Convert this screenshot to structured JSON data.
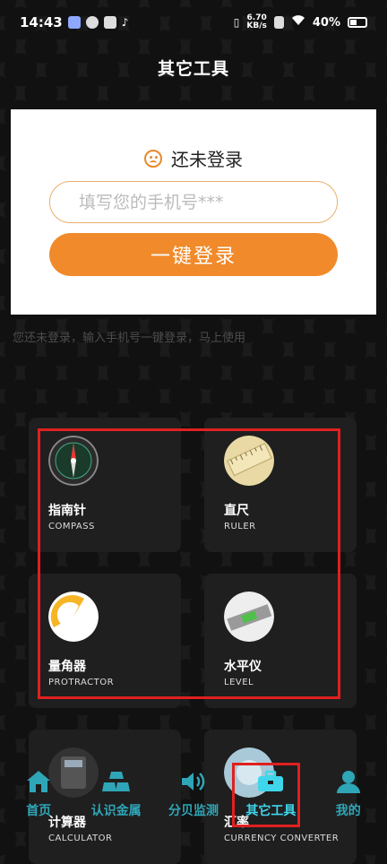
{
  "status_bar": {
    "time": "14:43",
    "net_speed_value": "6.70",
    "net_speed_unit": "KB/s",
    "battery": "40%"
  },
  "page": {
    "title": "其它工具"
  },
  "login": {
    "status_text": "还未登录",
    "phone_placeholder": "填写您的手机号***",
    "login_button": "一键登录",
    "hint": "您还未登录，输入手机号一键登录，马上使用"
  },
  "tools": [
    {
      "name": "指南针",
      "sub": "COMPASS",
      "icon": "compass-icon"
    },
    {
      "name": "直尺",
      "sub": "RULER",
      "icon": "ruler-icon"
    },
    {
      "name": "量角器",
      "sub": "PROTRACTOR",
      "icon": "protractor-icon"
    },
    {
      "name": "水平仪",
      "sub": "LEVEL",
      "icon": "level-icon"
    },
    {
      "name": "计算器",
      "sub": "CALCULATOR",
      "icon": "calculator-icon"
    },
    {
      "name": "汇率",
      "sub": "CURRENCY CONVERTER",
      "icon": "currency-icon"
    }
  ],
  "tabbar": {
    "items": [
      {
        "label": "首页",
        "icon": "home-icon"
      },
      {
        "label": "认识金属",
        "icon": "gold-bars-icon"
      },
      {
        "label": "分贝监测",
        "icon": "speaker-icon"
      },
      {
        "label": "其它工具",
        "icon": "toolbox-icon",
        "active": true
      },
      {
        "label": "我的",
        "icon": "user-icon"
      }
    ]
  },
  "colors": {
    "accent_orange": "#f08a2a",
    "tab_teal": "#2fa6b8",
    "highlight_red": "#e02020"
  }
}
